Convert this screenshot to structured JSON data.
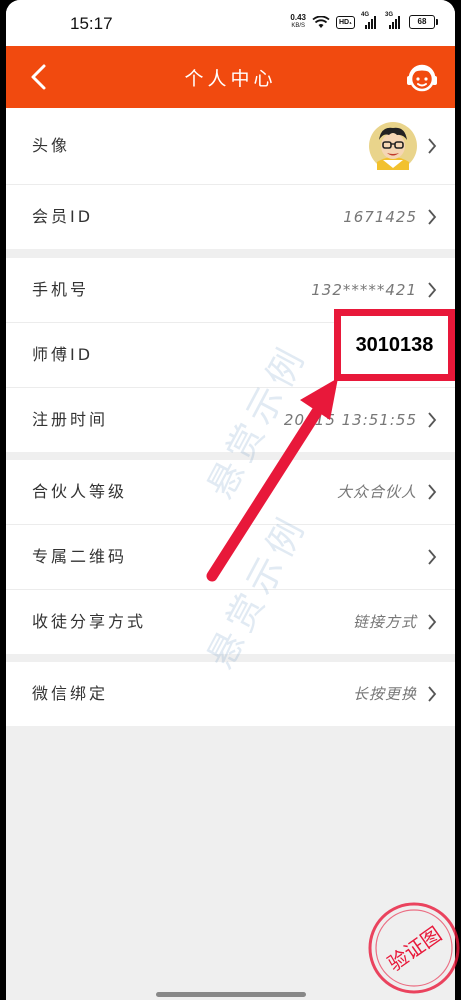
{
  "status_bar": {
    "time": "15:17",
    "net_speed_value": "0.43",
    "net_speed_unit": "KB/S",
    "hd_label": "HD₁",
    "signal_1_label": "4G",
    "signal_2_label": "3G",
    "battery": "68"
  },
  "nav": {
    "title": "个人中心"
  },
  "profile_group": {
    "avatar_label": "头像",
    "member_id_label": "会员ID",
    "member_id_value": "1671425"
  },
  "account_group": {
    "phone_label": "手机号",
    "phone_value": "132*****421",
    "master_id_label": "师傅ID",
    "register_time_label": "注册时间",
    "register_time_value": "20",
    "register_time_value_tail": "-15 13:51:55"
  },
  "partner_group": {
    "level_label": "合伙人等级",
    "level_value": "大众合伙人",
    "qrcode_label": "专属二维码",
    "share_label": "收徒分享方式",
    "share_value": "链接方式"
  },
  "wechat_group": {
    "bind_label": "微信绑定",
    "bind_value": "长按更换"
  },
  "annotation": {
    "master_id_value": "3010138",
    "color": "#e8183a"
  },
  "watermark": {
    "text": "悬赏示例"
  },
  "stamp": {
    "text": "验证图"
  },
  "colors": {
    "nav_bg": "#f14a0f",
    "annotation": "#e8183a"
  }
}
